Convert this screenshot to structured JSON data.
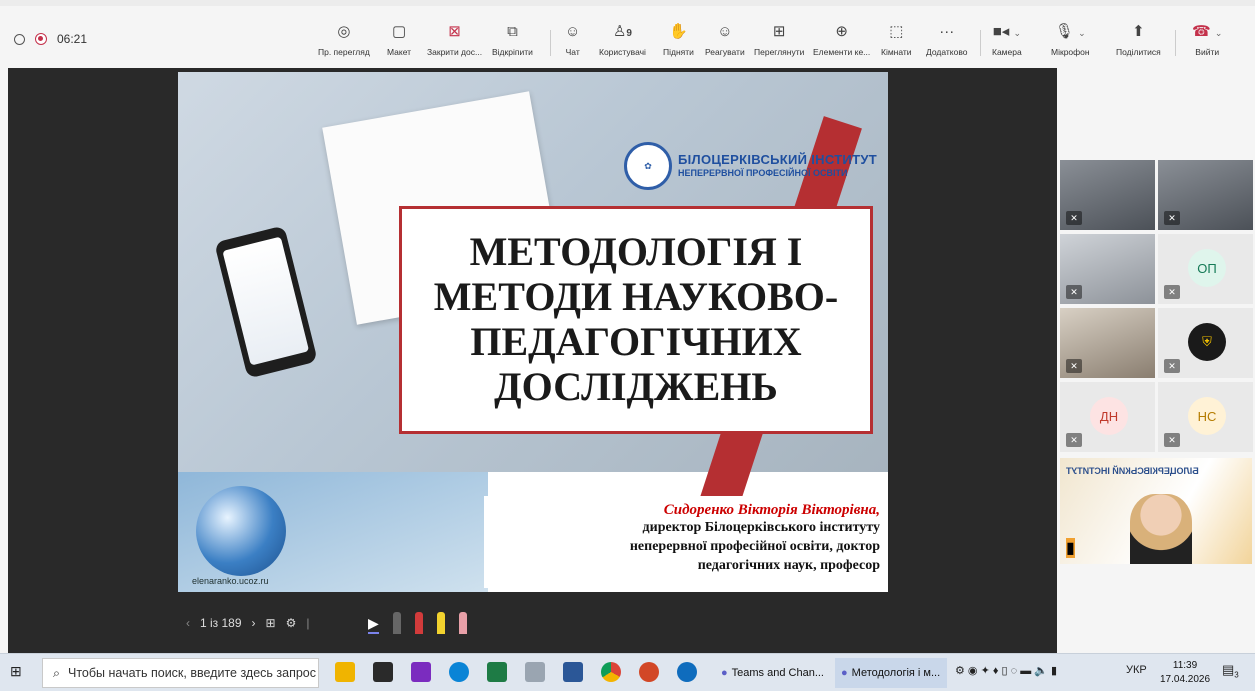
{
  "meeting": {
    "elapsed": "06:21"
  },
  "toolbar": [
    {
      "key": "presenter_view",
      "label": "Пр. перегляд",
      "icon": "eye-icon"
    },
    {
      "key": "layout",
      "label": "Макет",
      "icon": "layout-icon"
    },
    {
      "key": "stop_sharing",
      "label": "Закрити дос...",
      "icon": "close-share-icon"
    },
    {
      "key": "pop_out",
      "label": "Відкріпити",
      "icon": "pop-out-icon"
    },
    {
      "key": "chat",
      "label": "Чат",
      "icon": "chat-icon"
    },
    {
      "key": "people",
      "label": "Користувачі",
      "icon": "people-icon",
      "badge": "9"
    },
    {
      "key": "raise",
      "label": "Підняти",
      "icon": "hand-icon"
    },
    {
      "key": "react",
      "label": "Реагувати",
      "icon": "smile-icon"
    },
    {
      "key": "view",
      "label": "Переглянути",
      "icon": "grid-icon"
    },
    {
      "key": "apps",
      "label": "Елементи ке...",
      "icon": "apps-icon"
    },
    {
      "key": "rooms",
      "label": "Кімнати",
      "icon": "rooms-icon"
    },
    {
      "key": "more",
      "label": "Додатково",
      "icon": "more-icon"
    },
    {
      "key": "camera",
      "label": "Камера",
      "icon": "camera-icon"
    },
    {
      "key": "mic",
      "label": "Мікрофон",
      "icon": "mic-icon"
    },
    {
      "key": "share",
      "label": "Поділитися",
      "icon": "share-icon"
    },
    {
      "key": "leave",
      "label": "Вийти",
      "icon": "leave-icon"
    }
  ],
  "slide": {
    "logo_line1": "БІЛОЦЕРКІВСЬКИЙ ІНСТИТУТ",
    "logo_line2": "НЕПЕРЕРВНОЇ ПРОФЕСІЙНОЇ ОСВІТИ",
    "title_lines": [
      "МЕТОДОЛОГІЯ І",
      "МЕТОДИ НАУКОВО-",
      "ПЕДАГОГІЧНИХ",
      "ДОСЛІДЖЕНЬ"
    ],
    "author_name": "Сидоренко Вікторія Вікторівна,",
    "author_lines": [
      "директор Білоцерківського інституту",
      "неперервної професійної освіти, доктор",
      "педагогічних наук, професор"
    ],
    "watermark": "elenaranko.ucoz.ru"
  },
  "slide_nav": {
    "position": "1 із 189"
  },
  "gallery": {
    "initials": [
      "ОП",
      "ДН",
      "НС"
    ],
    "share_text": "БІЛОЦЕРКІВСЬКИЙ ІНСТИТУТ"
  },
  "taskbar": {
    "search_placeholder": "Чтобы начать поиск, введите здесь запрос",
    "tasks": [
      "Teams and Chan...",
      "Методологія і м..."
    ],
    "lang": "УКР",
    "time": "11:39",
    "date": "17.04.2026",
    "notifications": "3"
  }
}
